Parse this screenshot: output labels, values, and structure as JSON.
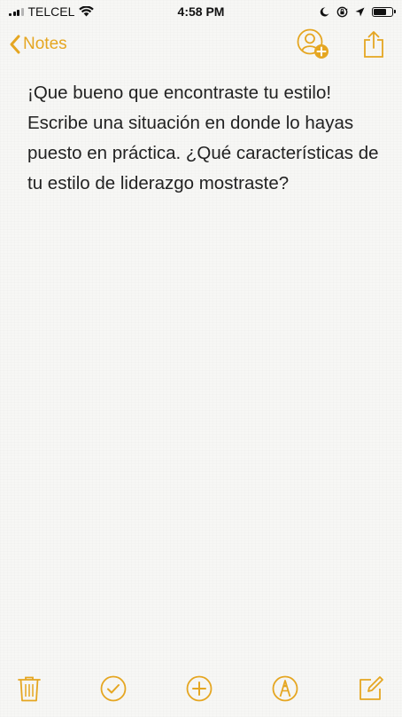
{
  "status_bar": {
    "carrier": "TELCEL",
    "time": "4:58 PM",
    "battery_level": 0.7,
    "icons": [
      "signal-icon",
      "wifi-icon",
      "moon-icon",
      "rotation-lock-icon",
      "location-icon",
      "battery-icon"
    ]
  },
  "nav": {
    "back_label": "Notes",
    "actions": [
      "add-person-icon",
      "share-icon"
    ]
  },
  "note": {
    "text": "¡Que bueno que encontraste tu estilo! Escribe una situación en donde lo hayas puesto en práctica. ¿Qué características de tu estilo de liderazgo mostraste?"
  },
  "toolbar": {
    "icons": [
      "trash-icon",
      "checklist-icon",
      "add-icon",
      "markup-icon",
      "compose-icon"
    ]
  },
  "colors": {
    "accent": "#e5a621",
    "text": "#222222",
    "background": "#f7f7f5"
  }
}
